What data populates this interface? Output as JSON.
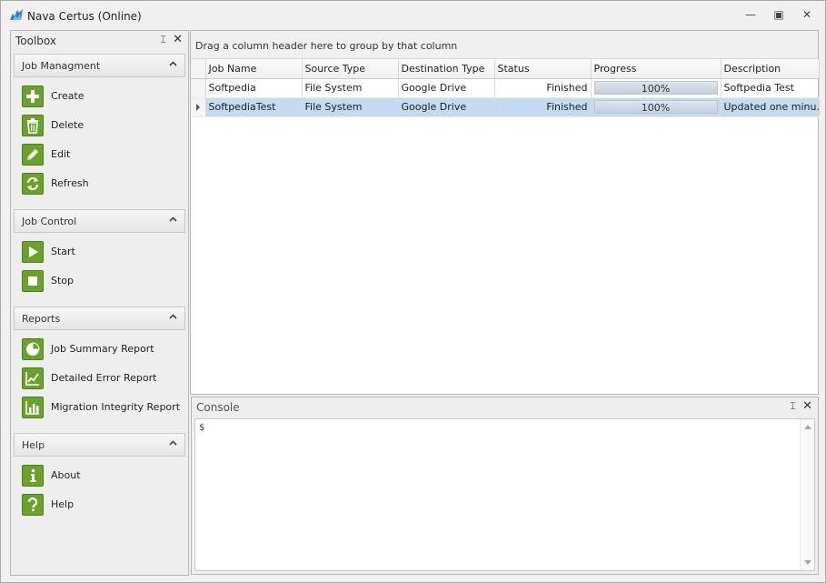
{
  "window": {
    "title": "Nava Certus (Online)",
    "minimize_glyph": "—",
    "maximize_glyph": "▣",
    "close_glyph": "✕"
  },
  "toolbox": {
    "title": "Toolbox",
    "pin_glyph": "⌶",
    "close_glyph": "✕",
    "groups": [
      {
        "label": "Job Managment",
        "items": [
          {
            "label": "Create",
            "icon": "plus-icon"
          },
          {
            "label": "Delete",
            "icon": "trash-icon"
          },
          {
            "label": "Edit",
            "icon": "pencil-icon"
          },
          {
            "label": "Refresh",
            "icon": "refresh-icon"
          }
        ]
      },
      {
        "label": "Job Control",
        "items": [
          {
            "label": "Start",
            "icon": "play-icon"
          },
          {
            "label": "Stop",
            "icon": "stop-icon"
          }
        ]
      },
      {
        "label": "Reports",
        "items": [
          {
            "label": "Job Summary Report",
            "icon": "pie-chart-icon"
          },
          {
            "label": "Detailed Error Report",
            "icon": "line-chart-icon"
          },
          {
            "label": "Migration Integrity Report",
            "icon": "bar-chart-icon"
          }
        ]
      },
      {
        "label": "Help",
        "items": [
          {
            "label": "About",
            "icon": "info-icon"
          },
          {
            "label": "Help",
            "icon": "question-icon"
          }
        ]
      }
    ]
  },
  "grid": {
    "group_hint": "Drag a column header here to group by that column",
    "columns": [
      "Job Name",
      "Source Type",
      "Destination Type",
      "Status",
      "Progress",
      "Description"
    ],
    "rows": [
      {
        "job_name": "Softpedia",
        "source_type": "File System",
        "destination_type": "Google Drive",
        "status": "Finished",
        "progress": 100,
        "progress_text": "100%",
        "description": "Softpedia Test",
        "selected": false
      },
      {
        "job_name": "SoftpediaTest",
        "source_type": "File System",
        "destination_type": "Google Drive",
        "status": "Finished",
        "progress": 100,
        "progress_text": "100%",
        "description": "Updated one minu...",
        "selected": true
      }
    ]
  },
  "console": {
    "title": "Console",
    "prompt": "$",
    "pin_glyph": "⌶",
    "close_glyph": "✕"
  },
  "colors": {
    "accent_green": "#6aa22c",
    "selection_blue": "#c5daf0",
    "app_icon_blue": "#2a7fd4"
  }
}
